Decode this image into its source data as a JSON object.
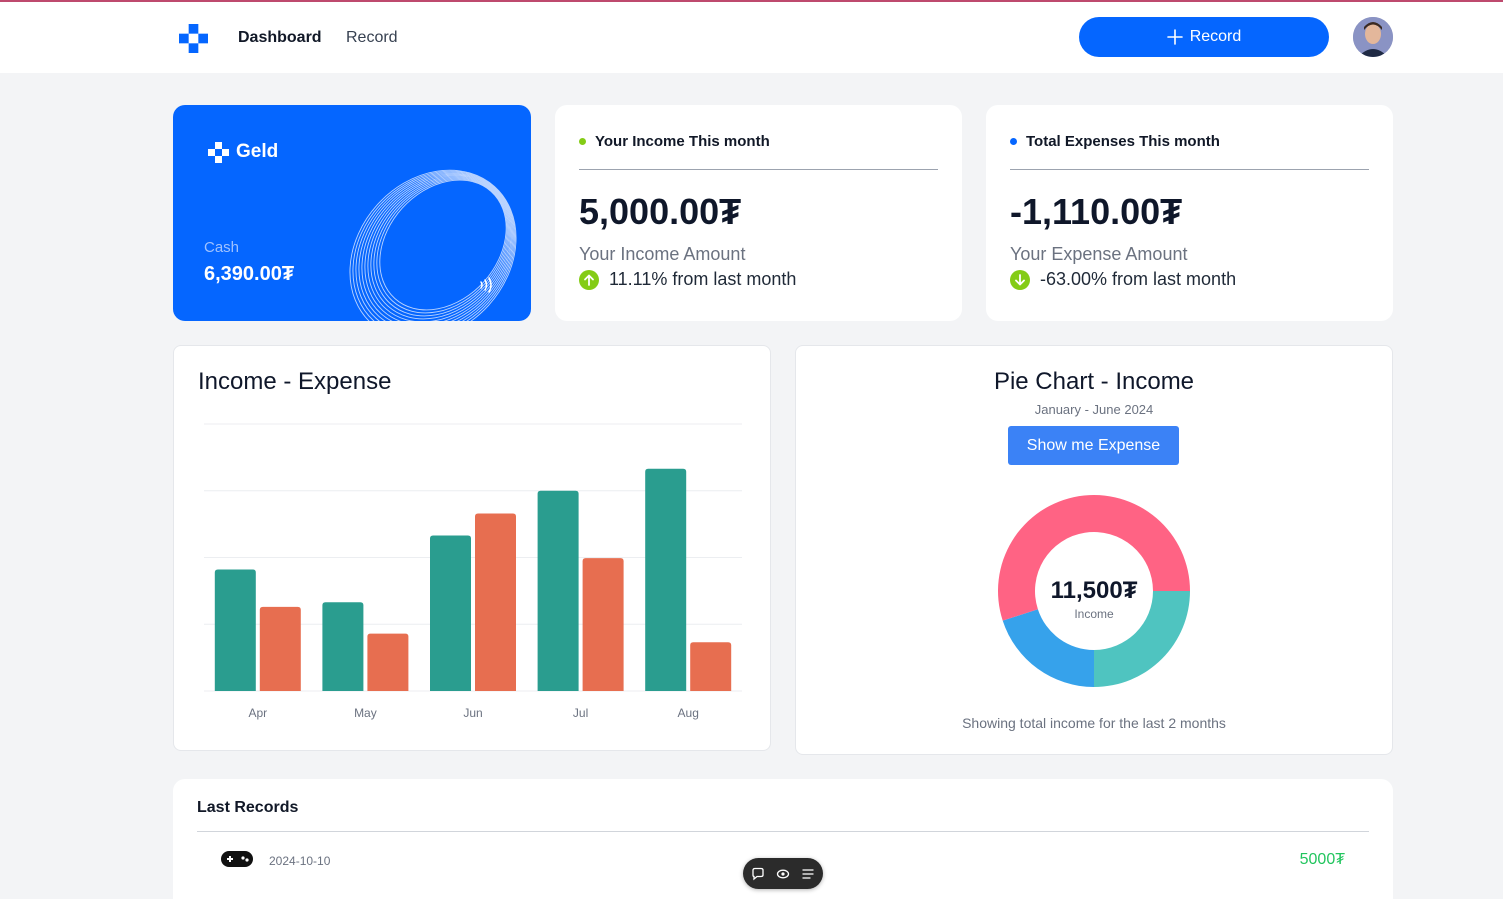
{
  "nav": {
    "links": [
      "Dashboard",
      "Record"
    ],
    "record_button": "Record"
  },
  "cash_card": {
    "brand": "Geld",
    "label": "Cash",
    "value": "6,390.00₮"
  },
  "income_card": {
    "title": "Your Income This month",
    "value": "5,000.00₮",
    "subtitle": "Your Income Amount",
    "trend": "11.11% from last month",
    "dot_color": "#84cc16",
    "trend_color": "#84cc16"
  },
  "expense_card": {
    "title": "Total Expenses This month",
    "value": "-1,110.00₮",
    "subtitle": "Your Expense Amount",
    "trend": "-63.00% from last month",
    "dot_color": "#0566ff",
    "trend_color": "#84cc16"
  },
  "bar_panel": {
    "title": "Income - Expense"
  },
  "pie_panel": {
    "title": "Pie Chart - Income",
    "subtitle": "January - June 2024",
    "button": "Show me Expense",
    "center_value": "11,500₮",
    "center_label": "Income",
    "footer": "Showing total income for the last 2 months"
  },
  "records": {
    "title": "Last Records",
    "rows": [
      {
        "icon": "gamepad-icon",
        "date": "2024-10-10",
        "amount": "5000₮"
      }
    ]
  },
  "chart_data": [
    {
      "type": "bar",
      "title": "Income - Expense",
      "categories": [
        "Apr",
        "May",
        "Jun",
        "Jul",
        "Aug"
      ],
      "series": [
        {
          "values": [
            1820,
            1330,
            2330,
            3000,
            3330
          ],
          "color": "#2a9d8f"
        },
        {
          "values": [
            1260,
            860,
            2660,
            1990,
            730
          ],
          "color": "#e76e50"
        }
      ],
      "ylim": [
        0,
        4000
      ],
      "grid": true
    },
    {
      "type": "pie",
      "title": "Pie Chart - Income",
      "slices": [
        {
          "value": 0.25,
          "color": "#4fc4c0"
        },
        {
          "value": 0.2,
          "color": "#36a2eb"
        },
        {
          "value": 0.55,
          "color": "#ff6384"
        }
      ]
    }
  ]
}
